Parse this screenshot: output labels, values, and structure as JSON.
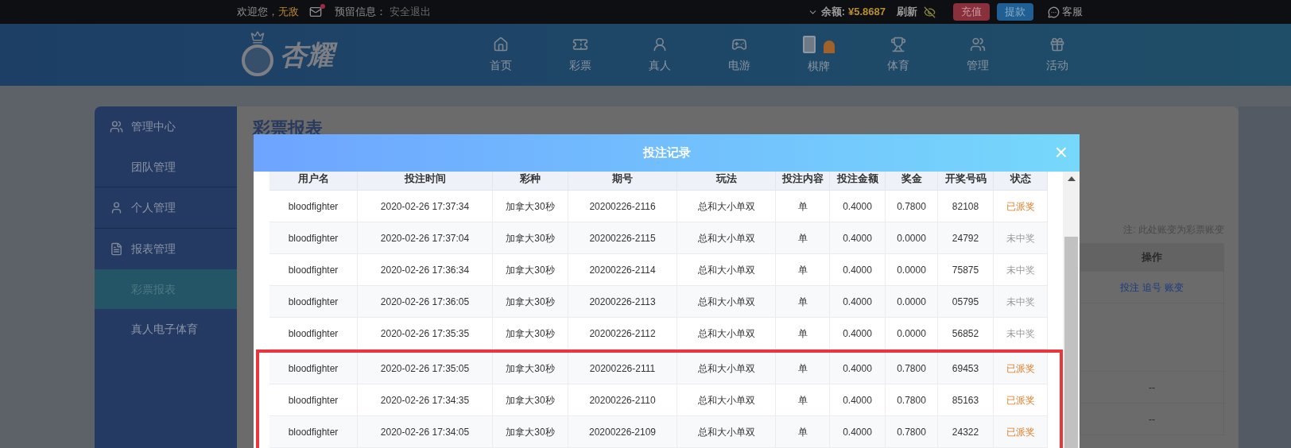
{
  "top_bar": {
    "greeting": "欢迎您，",
    "username": "无敌",
    "mail_unread": true,
    "reserved_info_label": "预留信息：",
    "logout": "安全退出",
    "balance_label": "余额:",
    "balance": "¥5.8687",
    "refresh": "刷新",
    "deposit": "充值",
    "withdraw": "提款",
    "support": "客服"
  },
  "logo": {
    "text": "杏耀"
  },
  "nav": [
    {
      "label": "首页"
    },
    {
      "label": "彩票"
    },
    {
      "label": "真人"
    },
    {
      "label": "电游"
    },
    {
      "label": "棋牌"
    },
    {
      "label": "体育"
    },
    {
      "label": "管理"
    },
    {
      "label": "活动"
    }
  ],
  "sidebar": {
    "groups": [
      {
        "label": "管理中心",
        "children": [
          {
            "label": "团队管理",
            "selected": false
          }
        ]
      },
      {
        "label": "个人管理"
      },
      {
        "label": "报表管理",
        "children": [
          {
            "label": "彩票报表",
            "selected": true
          },
          {
            "label": "真人电子体育",
            "selected": false
          }
        ]
      }
    ]
  },
  "page": {
    "title": "彩票报表",
    "note": "注: 此处账变为彩票账变",
    "table": {
      "column": "操作",
      "rows": [
        {
          "actions": [
            "投注",
            "追号",
            "账变"
          ]
        },
        {
          "actions": []
        },
        {
          "text": "--"
        },
        {
          "text": "--"
        }
      ]
    }
  },
  "modal": {
    "title": "投注记录",
    "close": "×",
    "columns": [
      "用户名",
      "投注时间",
      "彩种",
      "期号",
      "玩法",
      "投注内容",
      "投注金额",
      "奖金",
      "开奖号码",
      "状态"
    ],
    "rows": [
      {
        "cells": [
          "bloodfighter",
          "2020-02-26 17:37:34",
          "加拿大30秒",
          "20200226-2116",
          "总和大小单双",
          "单",
          "0.4000",
          "0.7800",
          "82108",
          "已派奖"
        ],
        "won": true,
        "highlighted": false
      },
      {
        "cells": [
          "bloodfighter",
          "2020-02-26 17:37:04",
          "加拿大30秒",
          "20200226-2115",
          "总和大小单双",
          "单",
          "0.4000",
          "0.0000",
          "24792",
          "未中奖"
        ],
        "won": false,
        "highlighted": false
      },
      {
        "cells": [
          "bloodfighter",
          "2020-02-26 17:36:34",
          "加拿大30秒",
          "20200226-2114",
          "总和大小单双",
          "单",
          "0.4000",
          "0.0000",
          "75875",
          "未中奖"
        ],
        "won": false,
        "highlighted": false
      },
      {
        "cells": [
          "bloodfighter",
          "2020-02-26 17:36:05",
          "加拿大30秒",
          "20200226-2113",
          "总和大小单双",
          "单",
          "0.4000",
          "0.0000",
          "05795",
          "未中奖"
        ],
        "won": false,
        "highlighted": false
      },
      {
        "cells": [
          "bloodfighter",
          "2020-02-26 17:35:35",
          "加拿大30秒",
          "20200226-2112",
          "总和大小单双",
          "单",
          "0.4000",
          "0.0000",
          "56852",
          "未中奖"
        ],
        "won": false,
        "highlighted": false
      },
      {
        "cells": [
          "bloodfighter",
          "2020-02-26 17:35:05",
          "加拿大30秒",
          "20200226-2111",
          "总和大小单双",
          "单",
          "0.4000",
          "0.7800",
          "69453",
          "已派奖"
        ],
        "won": true,
        "highlighted": true
      },
      {
        "cells": [
          "bloodfighter",
          "2020-02-26 17:34:35",
          "加拿大30秒",
          "20200226-2110",
          "总和大小单双",
          "单",
          "0.4000",
          "0.7800",
          "85163",
          "已派奖"
        ],
        "won": true,
        "highlighted": true
      },
      {
        "cells": [
          "bloodfighter",
          "2020-02-26 17:34:05",
          "加拿大30秒",
          "20200226-2109",
          "总和大小单双",
          "单",
          "0.4000",
          "0.7800",
          "24322",
          "已派奖"
        ],
        "won": true,
        "highlighted": true
      }
    ]
  }
}
